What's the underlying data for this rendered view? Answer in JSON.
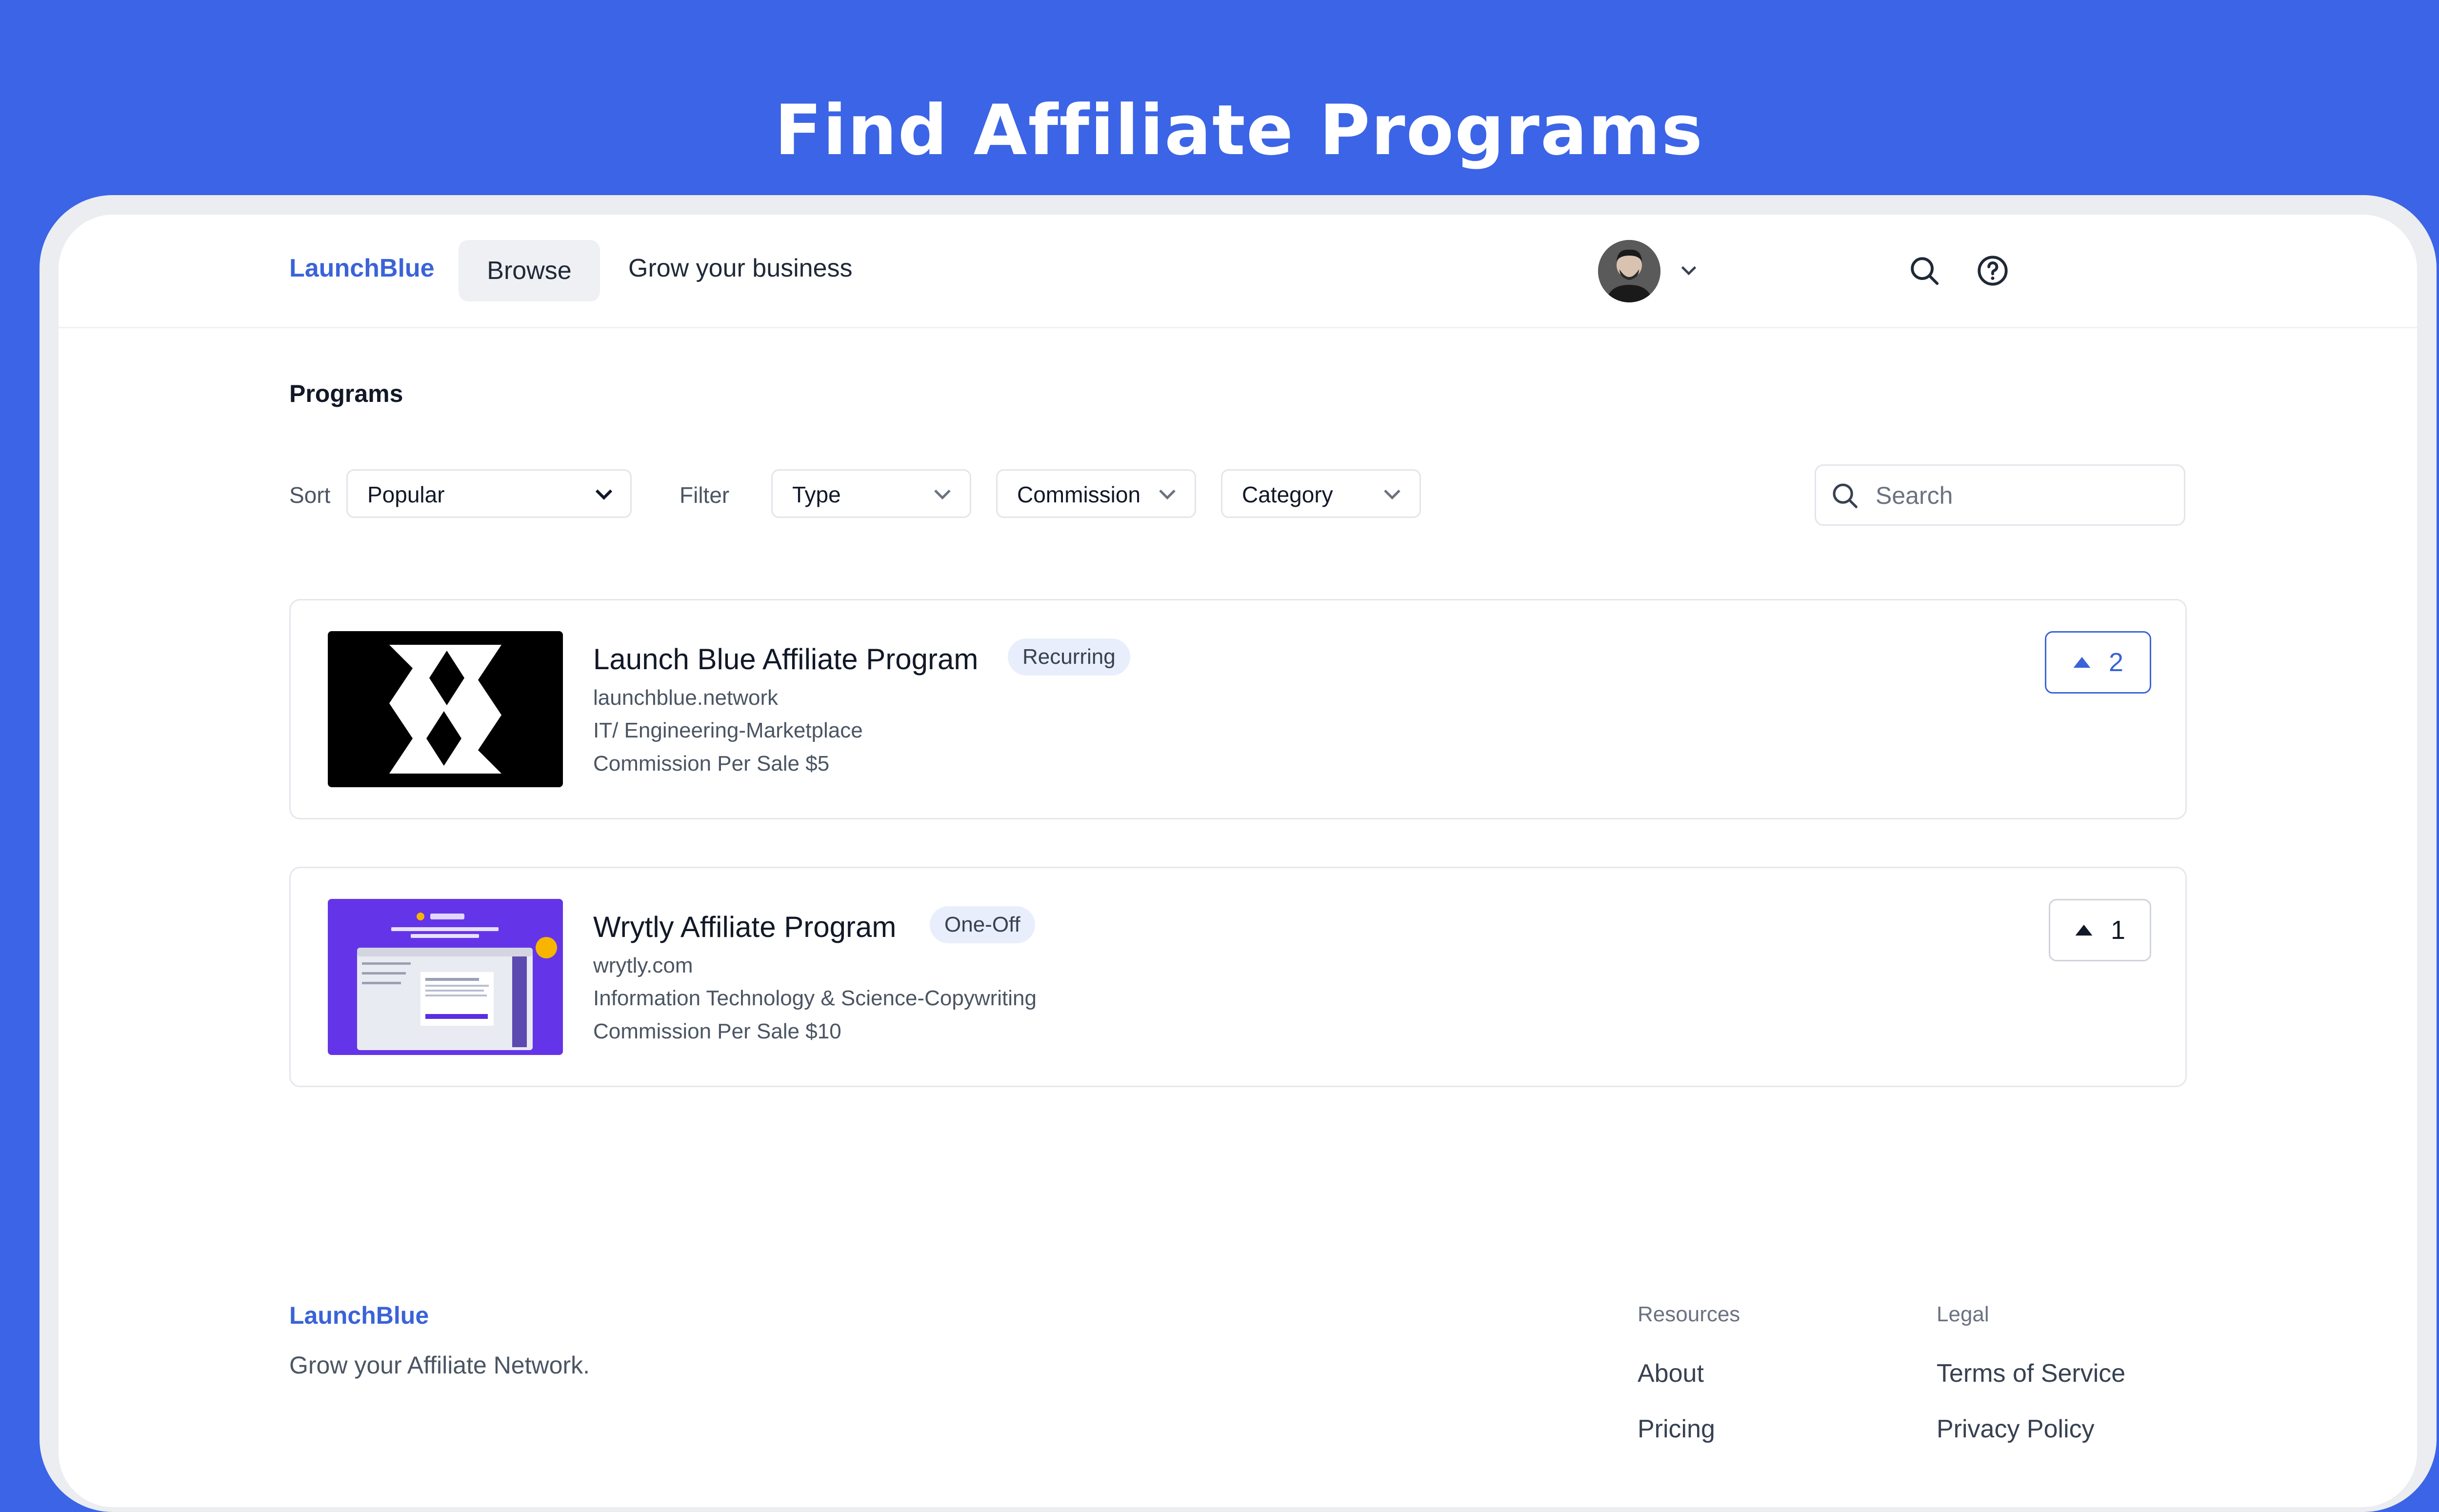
{
  "hero": {
    "title": "Find Affiliate Programs"
  },
  "header": {
    "brand": "LaunchBlue",
    "nav": {
      "browse": "Browse",
      "grow": "Grow your business"
    },
    "icons": [
      "search-icon",
      "help-icon",
      "avatar",
      "chevron-down-icon"
    ]
  },
  "page": {
    "title": "Programs"
  },
  "controls": {
    "sort_label": "Sort",
    "sort_value": "Popular",
    "filter_label": "Filter",
    "filters": [
      "Type",
      "Commission",
      "Category"
    ],
    "search_placeholder": "Search"
  },
  "programs": [
    {
      "name": "Launch Blue Affiliate Program",
      "badge": "Recurring",
      "domain": "launchblue.network",
      "category": "IT/ Engineering-Marketplace",
      "commission": "Commission Per Sale $5",
      "votes": "2",
      "voted": true
    },
    {
      "name": "Wrytly Affiliate Program",
      "badge": "One-Off",
      "domain": "wrytly.com",
      "category": "Information Technology & Science-Copywriting",
      "commission": "Commission Per Sale $10",
      "votes": "1",
      "voted": false
    }
  ],
  "footer": {
    "brand": "LaunchBlue",
    "tagline": "Grow your Affiliate Network.",
    "resources": {
      "heading": "Resources",
      "links": [
        "About",
        "Pricing"
      ]
    },
    "legal": {
      "heading": "Legal",
      "links": [
        "Terms of Service",
        "Privacy Policy"
      ]
    }
  },
  "colors": {
    "background": "#3b64e6",
    "brand": "#3a63d8",
    "badge_bg": "#e8eefb",
    "voted_border": "#3a63d8"
  }
}
